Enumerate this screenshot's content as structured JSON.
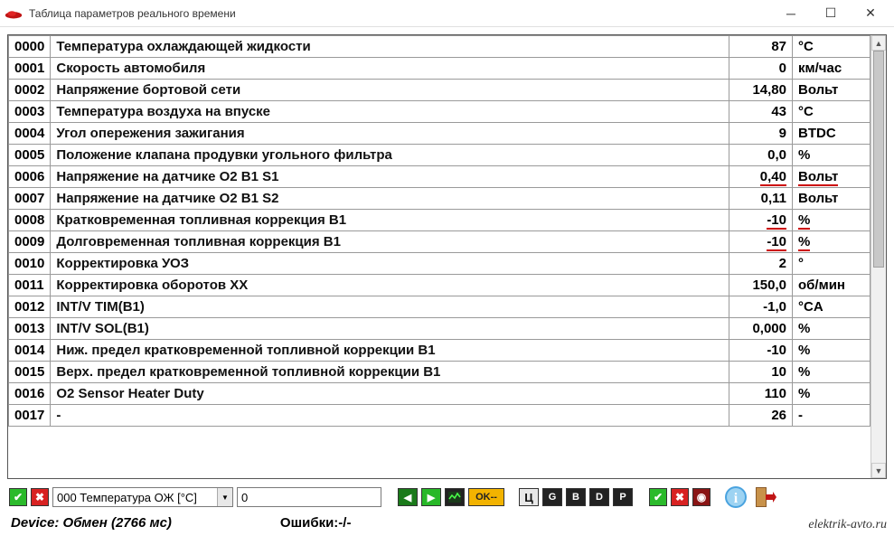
{
  "window": {
    "title": "Таблица параметров реального времени"
  },
  "dropdown": {
    "selected": "000 Температура ОЖ [°C]",
    "field_value": "0"
  },
  "status": {
    "device": "Device: Обмен (2766 мс)",
    "errors": "Ошибки:-/-"
  },
  "watermark": "elektrik-avto.ru",
  "rows": [
    {
      "code": "0000",
      "name": "Температура охлаждающей жидкости",
      "val": "87",
      "unit": "°C"
    },
    {
      "code": "0001",
      "name": "Скорость автомобиля",
      "val": "0",
      "unit": "км/час"
    },
    {
      "code": "0002",
      "name": "Напряжение бортовой сети",
      "val": "14,80",
      "unit": "Вольт"
    },
    {
      "code": "0003",
      "name": "Температура воздуха на впуске",
      "val": "43",
      "unit": "°C"
    },
    {
      "code": "0004",
      "name": "Угол опережения зажигания",
      "val": "9",
      "unit": "BTDC"
    },
    {
      "code": "0005",
      "name": "Положение клапана продувки угольного фильтра",
      "val": "0,0",
      "unit": "%"
    },
    {
      "code": "0006",
      "name": "Напряжение на датчике О2 B1 S1",
      "val": "0,40",
      "unit": "Вольт",
      "underline": true
    },
    {
      "code": "0007",
      "name": "Напряжение на датчике О2 B1 S2",
      "val": "0,11",
      "unit": "Вольт"
    },
    {
      "code": "0008",
      "name": "Кратковременная топливная коррекция B1",
      "val": "-10",
      "unit": "%",
      "underline": true
    },
    {
      "code": "0009",
      "name": "Долговременная топливная коррекция B1",
      "val": "-10",
      "unit": "%",
      "underline": true
    },
    {
      "code": "0010",
      "name": "Корректировка УОЗ",
      "val": "2",
      "unit": "°"
    },
    {
      "code": "0011",
      "name": "Корректировка оборотов ХХ",
      "val": "150,0",
      "unit": "об/мин"
    },
    {
      "code": "0012",
      "name": "INT/V TIM(B1)",
      "val": "-1,0",
      "unit": "°CA"
    },
    {
      "code": "0013",
      "name": "INT/V SOL(B1)",
      "val": "0,000",
      "unit": "%"
    },
    {
      "code": "0014",
      "name": "Ниж. предел кратковременной топливной коррекции B1",
      "val": "-10",
      "unit": "%"
    },
    {
      "code": "0015",
      "name": "Верх. предел кратковременной топливной коррекции B1",
      "val": "10",
      "unit": "%"
    },
    {
      "code": "0016",
      "name": "O2 Sensor Heater Duty",
      "val": "110",
      "unit": "%"
    },
    {
      "code": "0017",
      "name": "-",
      "val": "26",
      "unit": "-"
    }
  ],
  "ok_label": "OK--"
}
